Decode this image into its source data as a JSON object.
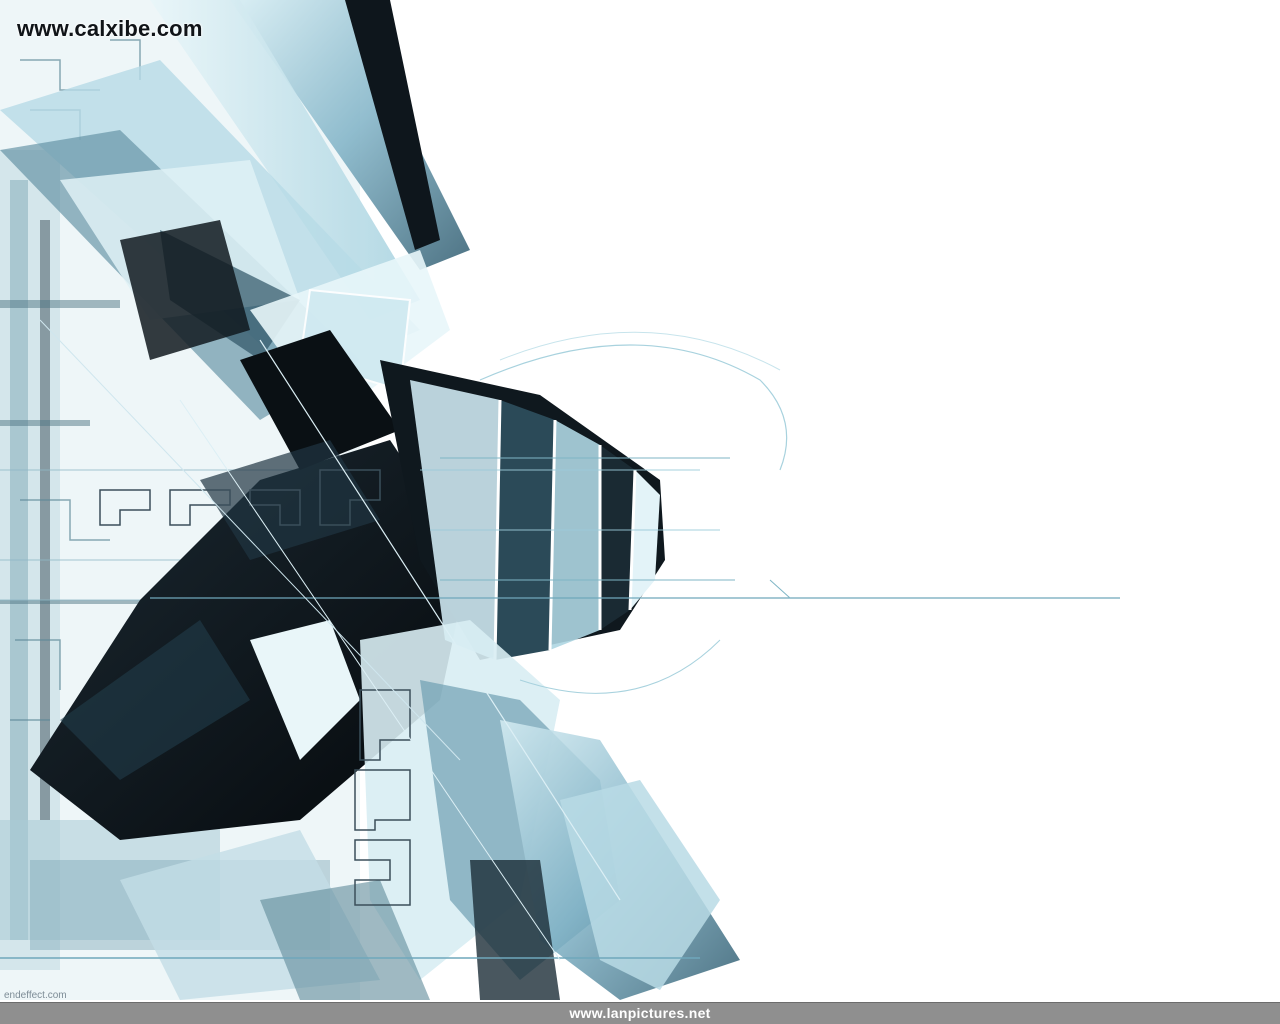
{
  "image": {
    "kind": "abstract-wallpaper",
    "palette": {
      "background": "#ffffff",
      "ink_dark": "#0c1116",
      "steel_blue": "#5e8ea4",
      "cyan_light": "#bfe4ee",
      "cyan_mid": "#8cc3d4",
      "line_accent": "#7fb6c6",
      "bottom_bar": "#8f8f8f"
    }
  },
  "watermarks": {
    "top_left": "www.calxibe.com",
    "bottom_center": "www.lanpictures.net",
    "bottom_left_credit": "endeffect.com"
  }
}
